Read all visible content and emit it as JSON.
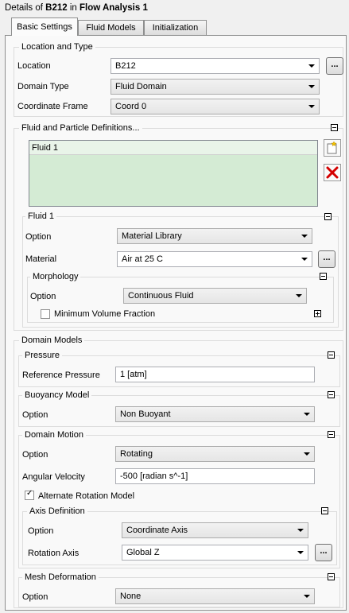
{
  "header": {
    "prefix": "Details of ",
    "object": "B212",
    "middle": " in ",
    "analysis": "Flow Analysis 1"
  },
  "tabs": [
    {
      "label": "Basic Settings"
    },
    {
      "label": "Fluid Models"
    },
    {
      "label": "Initialization"
    }
  ],
  "location_and_type": {
    "title": "Location and Type",
    "location_label": "Location",
    "location_value": "B212",
    "domain_type_label": "Domain Type",
    "domain_type_value": "Fluid Domain",
    "coord_frame_label": "Coordinate Frame",
    "coord_frame_value": "Coord 0"
  },
  "fluid_defs": {
    "title": "Fluid and Particle Definitions...",
    "items": [
      "Fluid 1"
    ]
  },
  "fluid1": {
    "title": "Fluid 1",
    "option_label": "Option",
    "option_value": "Material Library",
    "material_label": "Material",
    "material_value": "Air at 25 C",
    "morphology": {
      "title": "Morphology",
      "option_label": "Option",
      "option_value": "Continuous Fluid",
      "min_vol_label": "Minimum Volume Fraction"
    }
  },
  "domain_models": {
    "title": "Domain Models",
    "pressure": {
      "title": "Pressure",
      "ref_label": "Reference Pressure",
      "ref_value": "1 [atm]"
    },
    "buoyancy": {
      "title": "Buoyancy Model",
      "option_label": "Option",
      "option_value": "Non Buoyant"
    },
    "motion": {
      "title": "Domain Motion",
      "option_label": "Option",
      "option_value": "Rotating",
      "angular_label": "Angular Velocity",
      "angular_value": "-500 [radian s^-1]",
      "alt_rotation_label": "Alternate Rotation Model",
      "axis": {
        "title": "Axis Definition",
        "option_label": "Option",
        "option_value": "Coordinate Axis",
        "rotation_axis_label": "Rotation Axis",
        "rotation_axis_value": "Global Z"
      }
    },
    "mesh": {
      "title": "Mesh Deformation",
      "option_label": "Option",
      "option_value": "None"
    }
  },
  "icons": {
    "dots": "...",
    "check": "✓"
  }
}
